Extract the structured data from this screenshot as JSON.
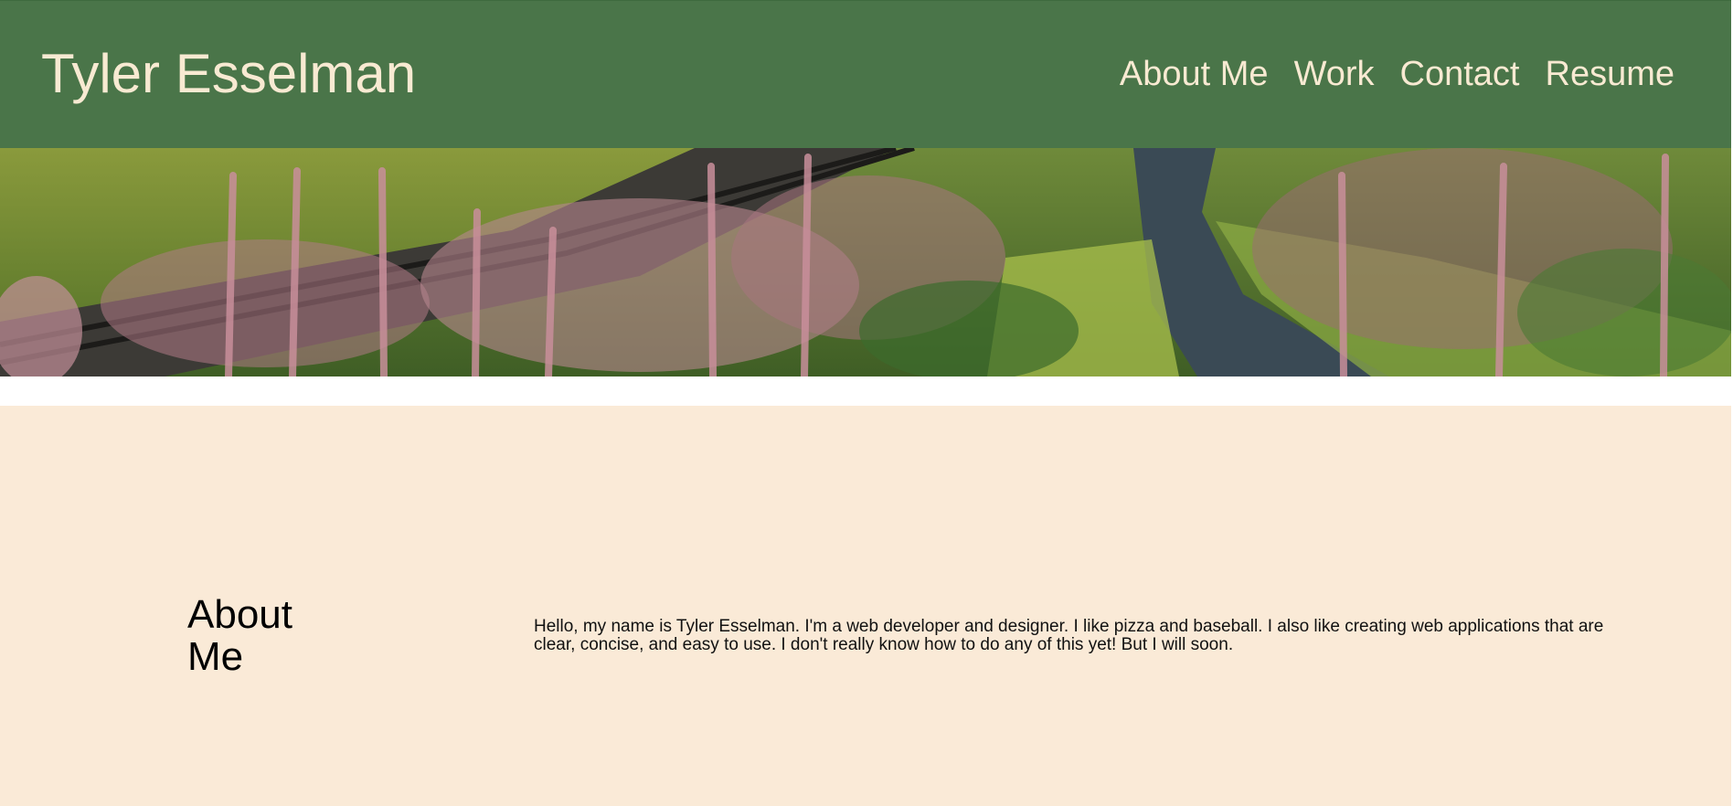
{
  "header": {
    "title": "Tyler Esselman",
    "nav": [
      "About Me",
      "Work",
      "Contact",
      "Resume"
    ]
  },
  "hero": {
    "alt": "Landscape photo of wildflowers beside a railway track and a gravel path"
  },
  "about": {
    "heading": "About Me",
    "text": "Hello, my name is Tyler Esselman. I'm a web developer and designer. I like pizza and baseball. I also like creating web applications that are clear, concise, and easy to use. I don't really know how to do any of this yet! But I will soon."
  },
  "colors": {
    "header_bg": "#4a7549",
    "header_text": "#f8ead2",
    "about_bg": "#faead7"
  }
}
